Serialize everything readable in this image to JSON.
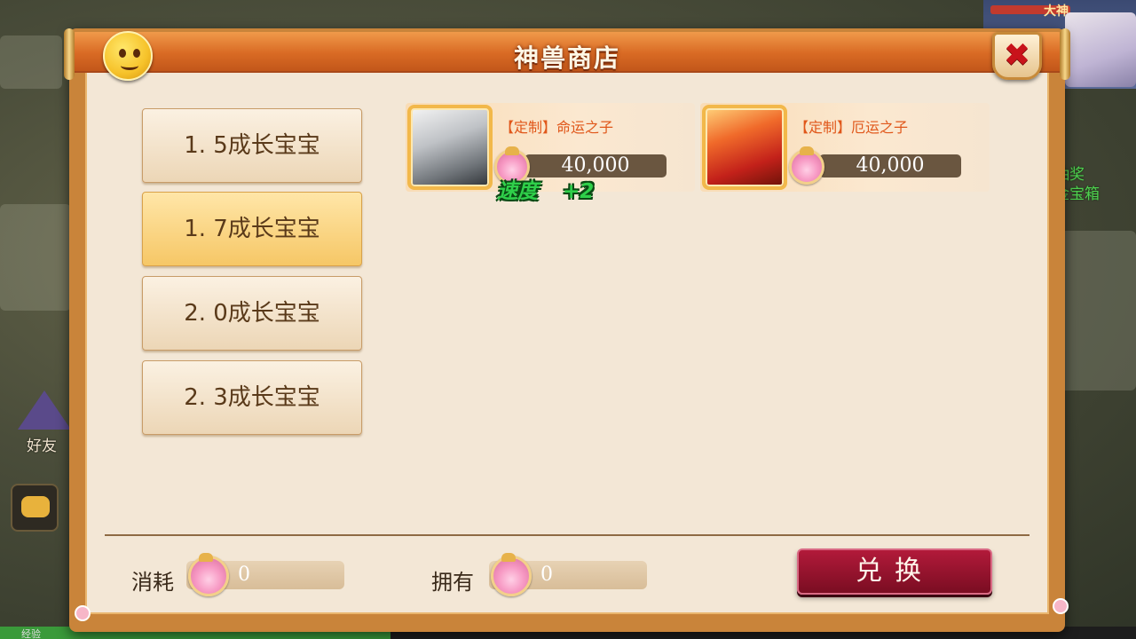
{
  "background": {
    "player_name": "大神",
    "lottery_label": "抽奖",
    "gold_chest_label": "金宝箱",
    "friend_label": "好友",
    "exp_label": "经验",
    "icons": [
      "chat-icon",
      "friend-icon",
      "player-portrait"
    ]
  },
  "shop": {
    "title": "神兽商店",
    "close_icon": "✖",
    "categories": [
      {
        "label": "1. 5成长宝宝",
        "active": false
      },
      {
        "label": "1. 7成长宝宝",
        "active": true
      },
      {
        "label": "2. 0成长宝宝",
        "active": false
      },
      {
        "label": "2. 3成长宝宝",
        "active": false
      }
    ],
    "items": [
      {
        "name": "【定制】命运之子",
        "price": "40,000",
        "portrait": "silver-armored-hero"
      },
      {
        "name": "【定制】厄运之子",
        "price": "40,000",
        "portrait": "fire-haired-hero"
      }
    ],
    "floating_bonus": {
      "stat": "速度",
      "value": "+2"
    },
    "footer": {
      "cost_label": "消耗",
      "cost_value": "0",
      "own_label": "拥有",
      "own_value": "0",
      "exchange_label": "兑换"
    }
  },
  "colors": {
    "title_bar": "#d96a24",
    "panel_bg": "#f3e7d6",
    "active_category": "#f6c766",
    "item_name": "#e0571a",
    "bonus_text": "#2fd04a",
    "exchange_button": "#9a1430"
  }
}
